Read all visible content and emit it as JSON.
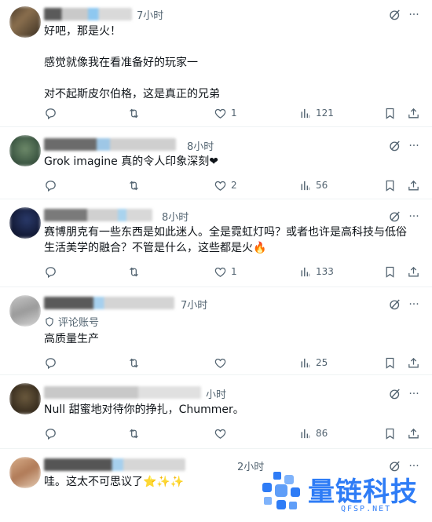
{
  "replies": [
    {
      "time": "7小时",
      "text": "好吧，那是火！\n\n感觉就像我在看准备好的玩家一\n\n对不起斯皮尔伯格，这是真正的兄弟",
      "replies": "",
      "retweets": "",
      "likes": "1",
      "views": "121"
    },
    {
      "time": "8小时",
      "text": "Grok imagine 真的令人印象深刻❤",
      "replies": "",
      "retweets": "",
      "likes": "2",
      "views": "56"
    },
    {
      "time": "8小时",
      "text": "赛博朋克有一些东西是如此迷人。全是霓虹灯吗？或者也许是高科技与低俗生活美学的融合？不管是什么，这些都是火🔥",
      "replies": "",
      "retweets": "",
      "likes": "1",
      "views": "133"
    },
    {
      "time": "7小时",
      "sub_label": "评论账号",
      "text": "高质量生产",
      "replies": "",
      "retweets": "",
      "likes": "",
      "views": "25"
    },
    {
      "time": "小时",
      "text": "Null 甜蜜地对待你的挣扎，Chummer。",
      "replies": "",
      "retweets": "",
      "likes": "",
      "views": "86"
    },
    {
      "time": "2小时",
      "text": "哇。这太不可思议了⭐✨✨"
    }
  ],
  "watermark": {
    "brand": "量链科技",
    "domain": "QFSP.NET"
  },
  "colors": {
    "text": "#0f1419",
    "muted": "#536471",
    "divider": "#eff3f4",
    "watermark": "#2e7cf6"
  }
}
